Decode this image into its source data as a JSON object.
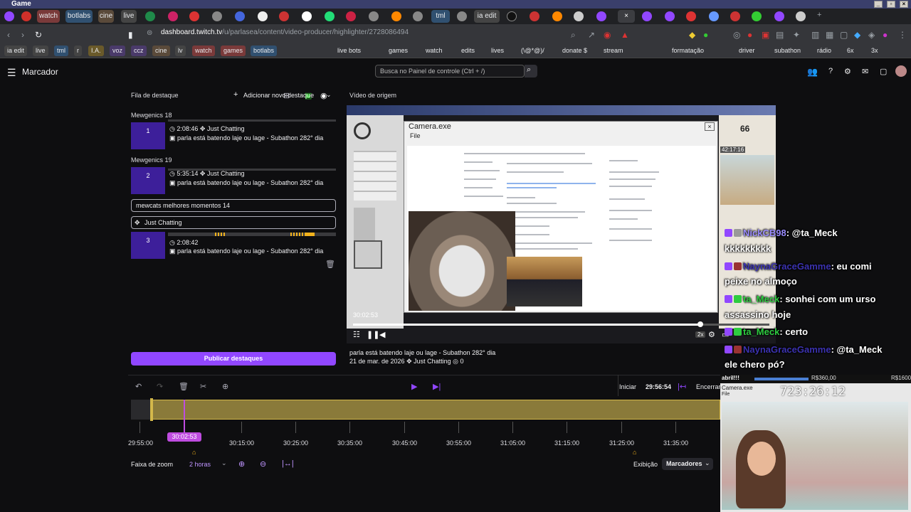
{
  "window": {
    "title": "Game"
  },
  "tabs": [
    "watch",
    "botlabs",
    "cine",
    "live",
    "tml",
    "ia edit"
  ],
  "address": {
    "host": "dashboard.twitch.tv",
    "path": "/u/parlasea/content/video-producer/highlighter/2728086494"
  },
  "bookmarks": [
    "ia edit",
    "live",
    "tml",
    "r",
    "I.A.",
    "voz",
    "ccz",
    "cine",
    "lv",
    "watch",
    "games",
    "botlabs",
    "live bots",
    "games",
    "watch",
    "edits",
    "lives",
    "(\\@*@)/",
    "donate $",
    "stream",
    "formatação",
    "driver",
    "subathon",
    "rádio",
    "6x",
    "3x"
  ],
  "header": {
    "menu_icon": "hamburger-icon",
    "title": "Marcador",
    "search_placeholder": "Busca no Painel de controle (Ctrl + /)"
  },
  "queue": {
    "title": "Fila de destaque",
    "add_button": "Adicionar novo destaque",
    "groups": [
      {
        "name": "Mewgenics 18",
        "number": "1",
        "duration": "2:08:46",
        "category": "Just Chatting",
        "stream_title": "parla está batendo laje ou lage - Subathon 282° dia"
      },
      {
        "name": "Mewgenics 19",
        "number": "2",
        "duration": "5:35:14",
        "category": "Just Chatting",
        "stream_title": "parla está batendo laje ou lage - Subathon 282° dia"
      }
    ],
    "editing": {
      "title_value": "mewcats melhores momentos 14",
      "category_value": "Just Chatting",
      "number": "3",
      "duration": "2:08:42",
      "stream_title": "parla está batendo laje ou lage - Subathon 282° dia"
    },
    "publish_button": "Publicar destaques"
  },
  "source": {
    "title": "Vídeo de origem",
    "video_time": "30:02:53",
    "progress_fraction": 0.83,
    "stream_title": "parla está batendo laje ou lage - Subathon 282° dia",
    "date": "21 de mar. de 2026",
    "category": "Just Chatting",
    "views": "0",
    "speed": "2x",
    "cam_window_title": "Camera.exe",
    "cam_window_menu": "File",
    "game_score": "66",
    "game_timer": "42:17:16"
  },
  "chat": [
    {
      "user": "NickCB98",
      "text": ": @ta_Meck",
      "cont": "kkkkkkkkk"
    },
    {
      "user": "NaynaGraceGamme",
      "text": ": eu comi",
      "cont": "peixe no almoço"
    },
    {
      "user": "ta_Meck",
      "text": ": sonhei com um urso",
      "cont": "assassino hoje"
    },
    {
      "user": "ta_Meck",
      "text": ": certo",
      "cont": ""
    },
    {
      "user": "NaynaGraceGamme",
      "text": ": @ta_Meck",
      "cont": "ele chero pó?"
    }
  ],
  "subathon": {
    "label": "abril!!!",
    "price1": "R$360,00",
    "price2": "R$1600",
    "timer": "723:26:12",
    "cam_title": "Camera.exe",
    "menu": "File"
  },
  "timeline": {
    "start_label": "Iniciar",
    "start_time": "29:56:54",
    "end_label": "Encerrar",
    "playhead": "30:02:53",
    "ticks": [
      "29:55:00",
      "30:15:00",
      "30:25:00",
      "30:35:00",
      "30:45:00",
      "30:55:00",
      "31:05:00",
      "31:15:00",
      "31:25:00",
      "31:35:00"
    ],
    "zoom_label": "Faixa de zoom",
    "zoom_value": "2 horas",
    "display_label": "Exibição",
    "display_value": "Marcadores"
  }
}
